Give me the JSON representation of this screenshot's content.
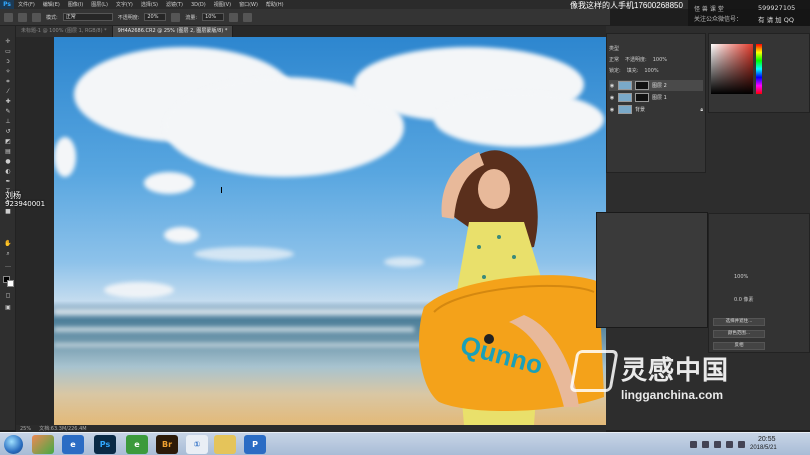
{
  "menubar": {
    "app_logo": "Ps",
    "items": [
      "文件(F)",
      "编辑(E)",
      "图像(I)",
      "图层(L)",
      "文字(Y)",
      "选择(S)",
      "滤镜(T)",
      "3D(D)",
      "视图(V)",
      "窗口(W)",
      "帮助(H)"
    ],
    "overlay_text": "像我这样的人手机17600268850",
    "promo_left": [
      "怪 兽 课 堂",
      "关注公众微信号："
    ],
    "promo_right": [
      "599927105",
      "有 请 加 QQ"
    ]
  },
  "options_bar": {
    "mode_label": "模式:",
    "mode_value": "正常",
    "opacity_label": "不透明度:",
    "opacity_value": "20%",
    "flow_label": "流量:",
    "flow_value": "10%"
  },
  "tabs": [
    {
      "label": "未标题-1 @ 100% (图层 1, RGB/8) *",
      "active": false
    },
    {
      "label": "9H4A2686.CR2 @ 25% (图层 2, 图层蒙版/8) *",
      "active": true
    }
  ],
  "overlay": {
    "name": "刘杨",
    "qq": "923940001"
  },
  "layers_panel": {
    "kind_label": "类型",
    "blend_mode": "正常",
    "opacity_label": "不透明度:",
    "opacity_value": "100%",
    "lock_label": "锁定:",
    "fill_label": "填充:",
    "fill_value": "100%",
    "layers": [
      {
        "name": "图层 2",
        "selected": true
      },
      {
        "name": "图层 1",
        "selected": false
      },
      {
        "name": "背景",
        "selected": false
      }
    ]
  },
  "right_props": {
    "percent": "100%",
    "value": "0.0 像素",
    "buttons": [
      "选择并遮住...",
      "颜色范围...",
      "反相"
    ]
  },
  "canvas_status": {
    "zoom": "25%",
    "doc_info": "文档:63.3M/226.4M"
  },
  "watermark": {
    "cn": "灵感中国",
    "en": "lingganchina.com"
  },
  "taskbar": {
    "apps": [
      "Ps",
      "Br",
      "P"
    ],
    "time": "20:55",
    "date": "2018/5/21"
  },
  "colors": {
    "accent": "#31a8ff",
    "board": "#f4a21a"
  }
}
